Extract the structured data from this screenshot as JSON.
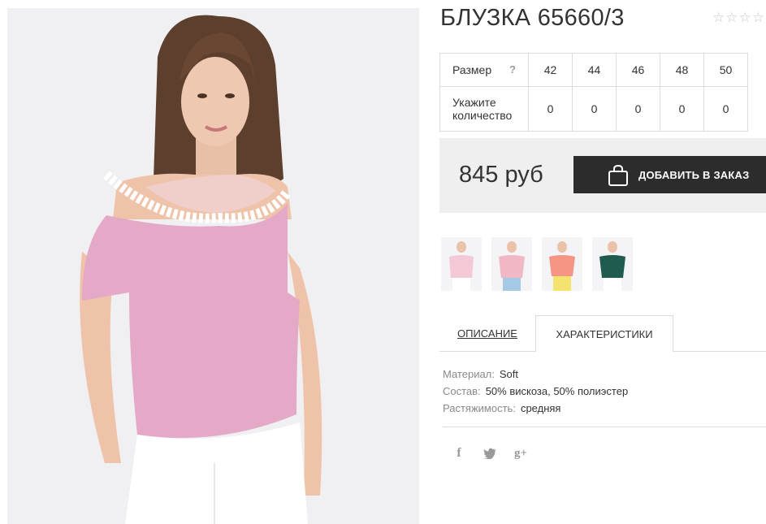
{
  "product": {
    "title": "БЛУЗКА 65660/3",
    "rating_stars": [
      "☆",
      "☆",
      "☆",
      "☆",
      "☆"
    ]
  },
  "size_table": {
    "size_label": "Размер",
    "help": "?",
    "sizes": [
      "42",
      "44",
      "46",
      "48",
      "50"
    ],
    "qty_label_line1": "Укажите",
    "qty_label_line2": "количество",
    "quantities": [
      "0",
      "0",
      "0",
      "0",
      "0"
    ]
  },
  "purchase": {
    "price": "845 руб",
    "add_button_label": "ДОБАВИТЬ В ЗАКАЗ"
  },
  "thumbnails": [
    {
      "name": "thumb-light-pink",
      "color": "#f3c9d6"
    },
    {
      "name": "thumb-pink-lace",
      "color": "#f0b8c4"
    },
    {
      "name": "thumb-coral",
      "color": "#f59583"
    },
    {
      "name": "thumb-green",
      "color": "#1f5b4e"
    }
  ],
  "tabs": {
    "description": "ОПИСАНИЕ",
    "characteristics": "ХАРАКТЕРИСТИКИ"
  },
  "specs": [
    {
      "key": "Материал:",
      "value": "Soft"
    },
    {
      "key": "Состав:",
      "value": "50% вискоза, 50% полиэстер"
    },
    {
      "key": "Растяжимость:",
      "value": "средняя"
    }
  ],
  "social": {
    "facebook": "f",
    "twitter": "t",
    "gplus": "g+"
  },
  "colors": {
    "accent_dark": "#2c2c2c",
    "price_bg": "#efefef",
    "blouse_pink": "#e3a9c6"
  }
}
